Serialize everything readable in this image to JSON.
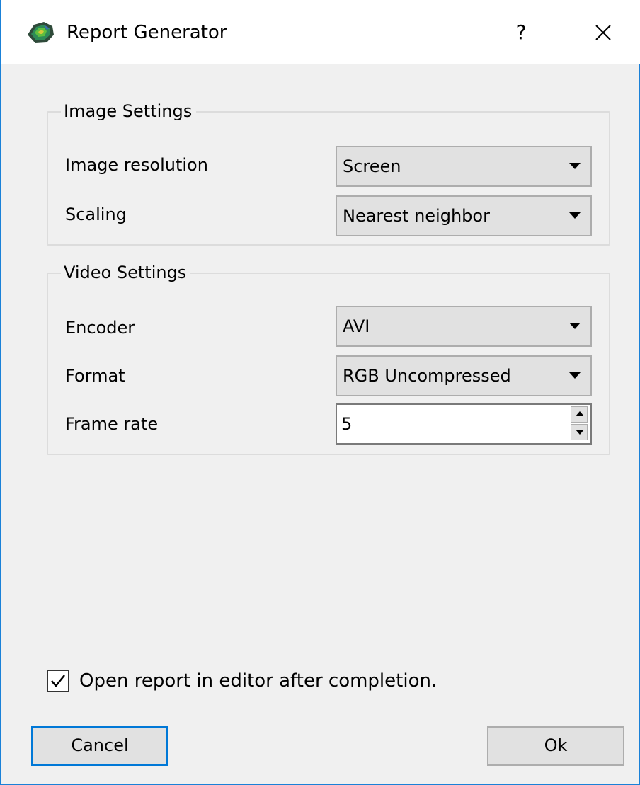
{
  "window": {
    "title": "Report Generator",
    "help_label": "?",
    "icons": {
      "app": "app-logo-icon",
      "close": "close-icon"
    },
    "accent_color": "#0078d7"
  },
  "image_settings": {
    "legend": "Image Settings",
    "resolution": {
      "label": "Image resolution",
      "value": "Screen"
    },
    "scaling": {
      "label": "Scaling",
      "value": "Nearest neighbor"
    }
  },
  "video_settings": {
    "legend": "Video Settings",
    "encoder": {
      "label": "Encoder",
      "value": "AVI"
    },
    "format": {
      "label": "Format",
      "value": "RGB Uncompressed"
    },
    "frame_rate": {
      "label": "Frame rate",
      "value": "5"
    }
  },
  "open_in_editor": {
    "label": "Open report in editor after completion.",
    "checked": true
  },
  "buttons": {
    "cancel": "Cancel",
    "ok": "Ok"
  }
}
